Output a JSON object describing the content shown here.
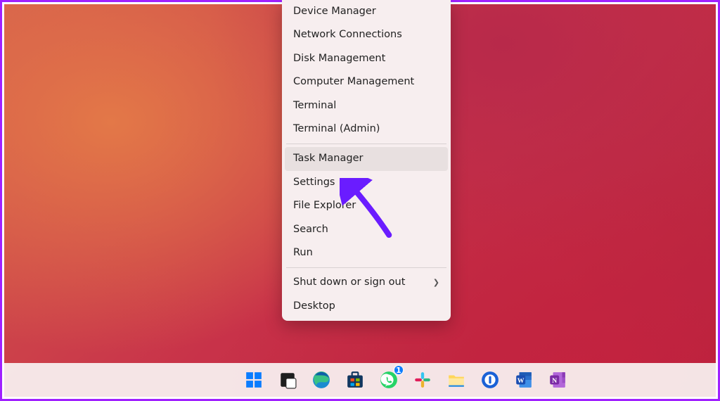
{
  "context_menu": {
    "groups": [
      [
        {
          "id": "device-manager",
          "label": "Device Manager"
        },
        {
          "id": "network-connections",
          "label": "Network Connections"
        },
        {
          "id": "disk-management",
          "label": "Disk Management"
        },
        {
          "id": "computer-management",
          "label": "Computer Management"
        },
        {
          "id": "terminal",
          "label": "Terminal"
        },
        {
          "id": "terminal-admin",
          "label": "Terminal (Admin)"
        }
      ],
      [
        {
          "id": "task-manager",
          "label": "Task Manager",
          "highlighted": true
        },
        {
          "id": "settings",
          "label": "Settings"
        },
        {
          "id": "file-explorer",
          "label": "File Explorer"
        },
        {
          "id": "search",
          "label": "Search"
        },
        {
          "id": "run",
          "label": "Run"
        }
      ],
      [
        {
          "id": "shut-down-or-sign-out",
          "label": "Shut down or sign out",
          "submenu": true
        },
        {
          "id": "desktop",
          "label": "Desktop"
        }
      ]
    ]
  },
  "taskbar": {
    "items": [
      {
        "id": "start",
        "name": "start-button",
        "icon": "windows-icon"
      },
      {
        "id": "task-view",
        "name": "task-view-button",
        "icon": "task-view-icon"
      },
      {
        "id": "edge",
        "name": "edge-button",
        "icon": "edge-icon"
      },
      {
        "id": "store",
        "name": "microsoft-store-button",
        "icon": "store-icon"
      },
      {
        "id": "whatsapp",
        "name": "whatsapp-button",
        "icon": "whatsapp-icon",
        "badge": "1"
      },
      {
        "id": "slack",
        "name": "slack-button",
        "icon": "slack-icon"
      },
      {
        "id": "explorer",
        "name": "file-explorer-button",
        "icon": "folder-icon"
      },
      {
        "id": "1password",
        "name": "1password-button",
        "icon": "onepassword-icon"
      },
      {
        "id": "word",
        "name": "word-button",
        "icon": "word-icon"
      },
      {
        "id": "onenote",
        "name": "onenote-button",
        "icon": "onenote-icon"
      }
    ]
  },
  "annotation": {
    "arrow_target": "task-manager",
    "arrow_color": "#6a1cff"
  }
}
